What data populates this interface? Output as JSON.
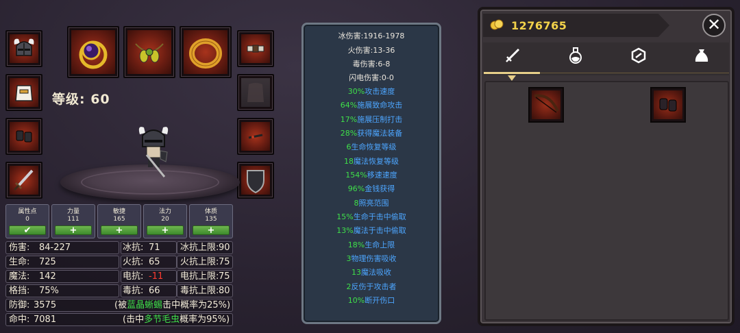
{
  "character": {
    "level_text": "等级: 60"
  },
  "attributes": [
    {
      "label": "属性点",
      "value": "0",
      "action": "✔"
    },
    {
      "label": "力量",
      "value": "111",
      "action": "+"
    },
    {
      "label": "敏捷",
      "value": "165",
      "action": "+"
    },
    {
      "label": "法力",
      "value": "20",
      "action": "+"
    },
    {
      "label": "体质",
      "value": "135",
      "action": "+"
    }
  ],
  "stats": {
    "damage": {
      "label": "伤害:",
      "value": "84-227"
    },
    "life": {
      "label": "生命:",
      "value": "725"
    },
    "mana": {
      "label": "魔法:",
      "value": "142"
    },
    "block": {
      "label": "格挡:",
      "value": "75%"
    },
    "defense": {
      "label": "防御:",
      "value": "3575"
    },
    "hit": {
      "label": "命中:",
      "value": "7081"
    },
    "cold_res": {
      "label": "冰抗:",
      "value": "71"
    },
    "fire_res": {
      "label": "火抗:",
      "value": "65"
    },
    "light_res": {
      "label": "电抗:",
      "value": "-11"
    },
    "poison_res": {
      "label": "毒抗:",
      "value": "66"
    },
    "cold_max": {
      "label": "冰抗上限:",
      "value": "90"
    },
    "fire_max": {
      "label": "火抗上限:",
      "value": "75"
    },
    "light_max": {
      "label": "电抗上限:",
      "value": "75"
    },
    "poison_max": {
      "label": "毒抗上限:",
      "value": "80"
    },
    "defense_note": {
      "pre": "(被",
      "monster": "蓝晶蜥蜴",
      "post": "击中概率为25%)"
    },
    "hit_note": {
      "pre": "(击中",
      "monster": "多节毛虫",
      "post": "概率为95%)"
    }
  },
  "bonuses": {
    "plain": [
      "冰伤害:1916-1978",
      "火伤害:13-36",
      "毒伤害:6-8",
      "闪电伤害:0-0"
    ],
    "colored": [
      {
        "num": "30%",
        "text": "攻击速度"
      },
      {
        "num": "64%",
        "text": "施展致命攻击"
      },
      {
        "num": "17%",
        "text": "施展压制打击"
      },
      {
        "num": "28%",
        "text": "获得魔法装备"
      },
      {
        "num": "6",
        "text": "生命恢复等级"
      },
      {
        "num": "18",
        "text": "魔法恢复等级"
      },
      {
        "num": "154%",
        "text": "移速速度"
      },
      {
        "num": "96%",
        "text": "金钱获得"
      },
      {
        "num": "8",
        "text": "照亮范围"
      },
      {
        "num": "15%",
        "text": "生命于击中偷取"
      },
      {
        "num": "13%",
        "text": "魔法于击中偷取"
      },
      {
        "num": "18%",
        "text": "生命上限"
      },
      {
        "num": "3",
        "text": "物理伤害吸收"
      },
      {
        "num": "13",
        "text": "魔法吸收"
      },
      {
        "num": "2",
        "text": "反伤于攻击者"
      },
      {
        "num": "10%",
        "text": "断开伤口"
      }
    ]
  },
  "inventory": {
    "gold": "1276765",
    "tabs": [
      "sword-icon",
      "potion-icon",
      "gem-icon",
      "bag-icon"
    ],
    "active_tab": 0
  },
  "colors": {
    "positive": "#3fe04a",
    "negative": "#ff3b30",
    "info": "#4da6ff",
    "gold": "#f3d34a"
  }
}
